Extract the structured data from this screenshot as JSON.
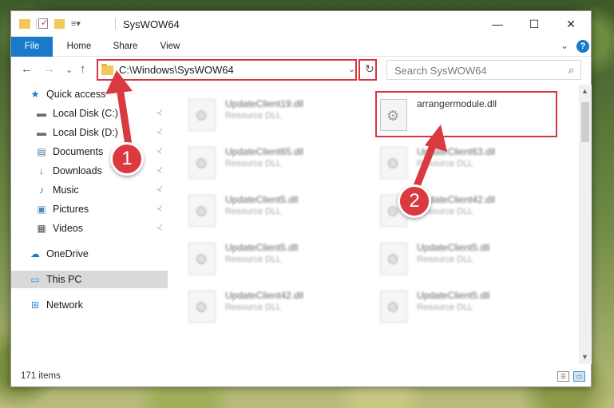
{
  "window": {
    "title": "SysWOW64",
    "controls": {
      "minimize": "—",
      "maximize": "☐",
      "close": "✕"
    }
  },
  "ribbon": {
    "tabs": [
      "File",
      "Home",
      "Share",
      "View"
    ],
    "expand_glyph": "⌄",
    "help_glyph": "?"
  },
  "nav": {
    "back": "←",
    "forward": "→",
    "recent": "⌄",
    "up": "↑",
    "address": "C:\\Windows\\SysWOW64",
    "address_dropdown": "⌄",
    "refresh": "↻",
    "search_placeholder": "Search SysWOW64",
    "search_glyph": "⌕"
  },
  "navpane": {
    "items": [
      {
        "label": "Quick access",
        "icon": "star-icon",
        "glyph": "★",
        "color": "#1979ca"
      },
      {
        "label": "Local Disk (C:)",
        "icon": "drive-icon",
        "glyph": "▬",
        "color": "#6a6a6a",
        "pinned": true
      },
      {
        "label": "Local Disk (D:)",
        "icon": "drive-icon",
        "glyph": "▬",
        "color": "#6a6a6a",
        "pinned": true
      },
      {
        "label": "Documents",
        "icon": "documents-icon",
        "glyph": "▤",
        "color": "#5a7ea8",
        "pinned": true
      },
      {
        "label": "Downloads",
        "icon": "download-icon",
        "glyph": "↓",
        "color": "#1979ca",
        "pinned": true
      },
      {
        "label": "Music",
        "icon": "music-icon",
        "glyph": "♪",
        "color": "#1979ca",
        "pinned": true
      },
      {
        "label": "Pictures",
        "icon": "pictures-icon",
        "glyph": "▣",
        "color": "#4a88c2",
        "pinned": true
      },
      {
        "label": "Videos",
        "icon": "videos-icon",
        "glyph": "▦",
        "color": "#555555",
        "pinned": true
      },
      {
        "label": "OneDrive",
        "icon": "cloud-icon",
        "glyph": "☁",
        "color": "#1979ca"
      },
      {
        "label": "This PC",
        "icon": "computer-icon",
        "glyph": "▭",
        "color": "#3c8ed6",
        "selected": true
      },
      {
        "label": "Network",
        "icon": "network-icon",
        "glyph": "⊞",
        "color": "#3c8ed6"
      }
    ],
    "pin_glyph": "📌"
  },
  "files": [
    {
      "name": "UpdateClient19.dll",
      "type": "Resource DLL",
      "col": 0,
      "row": 0,
      "blurred": true
    },
    {
      "name": "arrangermodule.dll",
      "type": "",
      "col": 1,
      "row": 0,
      "blurred": false
    },
    {
      "name": "UpdateClient65.dll",
      "type": "Resource DLL",
      "col": 0,
      "row": 1,
      "blurred": true
    },
    {
      "name": "UpdateClient63.dll",
      "type": "Resource DLL",
      "col": 1,
      "row": 1,
      "blurred": true
    },
    {
      "name": "UpdateClient5.dll",
      "type": "Resource DLL",
      "col": 0,
      "row": 2,
      "blurred": true
    },
    {
      "name": "UpdateClient42.dll",
      "type": "Resource DLL",
      "col": 1,
      "row": 2,
      "blurred": true
    },
    {
      "name": "UpdateClient5.dll",
      "type": "Resource DLL",
      "col": 0,
      "row": 3,
      "blurred": true
    },
    {
      "name": "UpdateClient5.dll",
      "type": "Resource DLL",
      "col": 1,
      "row": 3,
      "blurred": true
    },
    {
      "name": "UpdateClient42.dll",
      "type": "Resource DLL",
      "col": 0,
      "row": 4,
      "blurred": true
    },
    {
      "name": "UpdateClient5.dll",
      "type": "Resource DLL",
      "col": 1,
      "row": 4,
      "blurred": true
    }
  ],
  "status": {
    "item_count": "171 items"
  },
  "callouts": {
    "step1": "1",
    "step2": "2",
    "arrow_color": "#d9393f"
  }
}
